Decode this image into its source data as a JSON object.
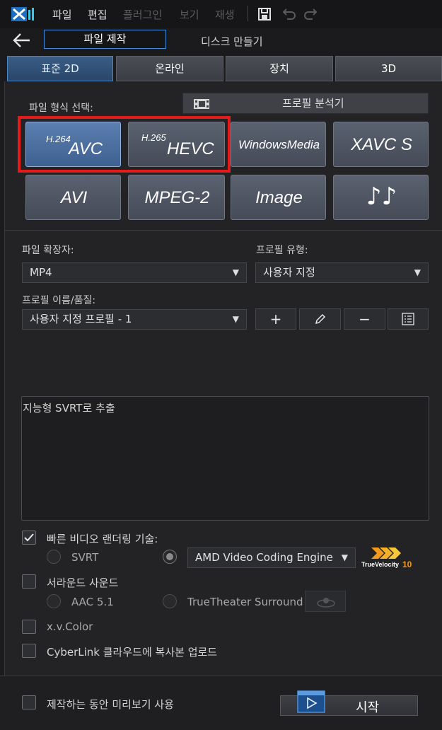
{
  "menu": {
    "file": "파일",
    "edit": "편집",
    "plugin": "플러그인",
    "view": "보기",
    "play": "재생"
  },
  "mode": {
    "produce_file": "파일 제작",
    "create_disc": "디스크 만들기"
  },
  "tabs": [
    "표준 2D",
    "온라인",
    "장치",
    "3D"
  ],
  "format_section": {
    "label": "파일 형식 선택:",
    "profile_analyzer": "프로필 분석기",
    "formats": [
      {
        "sup": "H.264",
        "main": "AVC"
      },
      {
        "sup": "H.265",
        "main": "HEVC"
      },
      {
        "sup": "",
        "main": "WindowsMedia"
      },
      {
        "sup": "",
        "main": "XAVC S"
      },
      {
        "sup": "",
        "main": "AVI"
      },
      {
        "sup": "",
        "main": "MPEG-2"
      },
      {
        "sup": "",
        "main": "Image"
      },
      {
        "sup": "",
        "main": "♪♪"
      }
    ]
  },
  "settings": {
    "extension_label": "파일 확장자:",
    "extension_value": "MP4",
    "profile_type_label": "프로필 유형:",
    "profile_type_value": "사용자 지정",
    "profile_name_label": "프로필 이름/품질:",
    "profile_name_value": "사용자 지정 프로필 - 1",
    "description": "지능형 SVRT로 추출"
  },
  "options": {
    "fast_render": "빠른 비디오 랜더링 기술:",
    "svrt": "SVRT",
    "engine": "AMD Video Coding Engine",
    "truevelocity": "TrueVelocity",
    "truevelocity_num": "10",
    "surround": "서라운드 사운드",
    "aac": "AAC 5.1",
    "truetheater": "TrueTheater Surround",
    "xvcolor": "x.v.Color",
    "cloud": "CyberLink 클라우드에 복사본 업로드"
  },
  "footer": {
    "preview": "제작하는 동안 미리보기 사용",
    "start": "시작"
  },
  "colors": {
    "accent": "#3a8ad8",
    "highlight": "#e31b1b",
    "tv_orange": "#f39a1e"
  }
}
